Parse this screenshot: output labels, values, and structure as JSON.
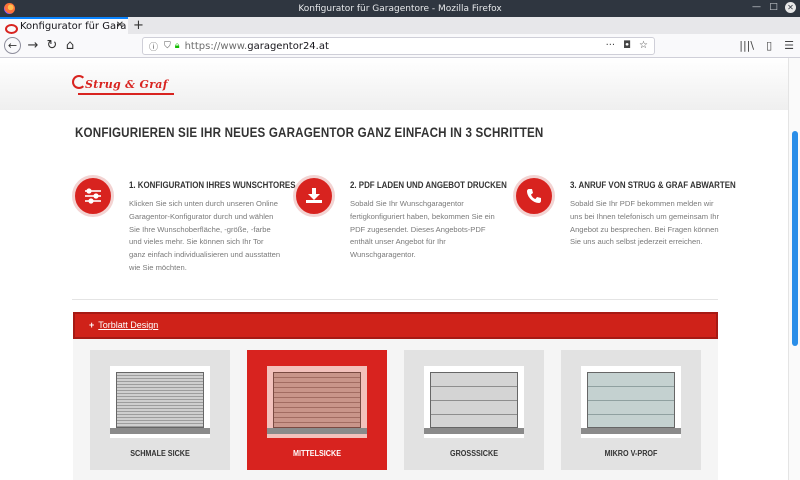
{
  "window": {
    "title": "Konfigurator für Garagentore - Mozilla Firefox",
    "minimize": "—",
    "maximize": "□",
    "close": "✕"
  },
  "tabs": [
    {
      "label": "Konfigurator für Gara",
      "close": "✕"
    }
  ],
  "newtab": "+",
  "nav": {
    "back": "←",
    "forward": "→",
    "reload": "↻",
    "home": "⌂"
  },
  "url": {
    "scheme": "https://www.",
    "host": "garagentor24.at"
  },
  "toolbar_right": {
    "library": "|||\\",
    "sidebar": "▯",
    "menu": "☰"
  },
  "logo": {
    "text": "Strug & Graf"
  },
  "headline": "KONFIGURIEREN SIE IHR NEUES GARAGENTOR GANZ EINFACH IN 3 SCHRITTEN",
  "steps": [
    {
      "icon": "sliders-icon",
      "glyph": "☰",
      "title": "1. KONFIGURATION IHRES WUNSCHTORES",
      "desc": "Klicken Sie sich unten durch unseren Online Garagentor-Konfigurator durch und wählen Sie Ihre Wunschoberfläche, -größe, -farbe und vieles mehr. Sie können sich Ihr Tor ganz einfach individualisieren und ausstatten wie Sie möchten."
    },
    {
      "icon": "download-icon",
      "glyph": "⬇",
      "title": "2. PDF LADEN UND ANGEBOT DRUCKEN",
      "desc": "Sobald Sie Ihr Wunschgaragentor fertigkonfiguriert haben, bekommen Sie ein PDF zugesendet. Dieses Angebots-PDF enthält unser Angebot für Ihr Wunschgaragentor."
    },
    {
      "icon": "phone-icon",
      "glyph": "✆",
      "title": "3. ANRUF VON STRUG & GRAF ABWARTEN",
      "desc": "Sobald Sie Ihr PDF bekommen melden wir uns bei Ihnen telefonisch um gemeinsam Ihr Angebot zu besprechen. Bei Fragen können Sie uns auch selbst jederzeit erreichen."
    }
  ],
  "section": {
    "label": "Torblatt Design"
  },
  "designs": [
    {
      "name": "SCHMALE SICKE",
      "pattern": "schmal",
      "active": false
    },
    {
      "name": "MITTELSICKE",
      "pattern": "mittel",
      "active": true
    },
    {
      "name": "GROSSSICKE",
      "pattern": "gross",
      "active": false
    },
    {
      "name": "MIKRO V-PROF",
      "pattern": "mikro",
      "active": false
    }
  ],
  "colors": {
    "brand_red": "#d8231f",
    "accent_blue": "#0a84ff"
  }
}
